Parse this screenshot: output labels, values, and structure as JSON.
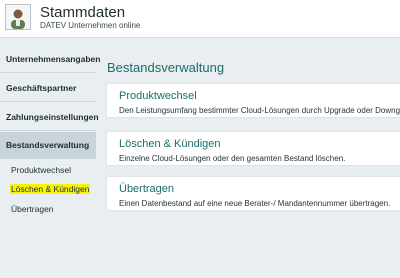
{
  "header": {
    "title": "Stammdaten",
    "subtitle": "DATEV Unternehmen online"
  },
  "sidebar": {
    "items": [
      {
        "label": "Unternehmensangaben"
      },
      {
        "label": "Geschäftspartner"
      },
      {
        "label": "Zahlungseinstellungen"
      },
      {
        "label": "Bestandsverwaltung"
      }
    ],
    "subitems": [
      {
        "label": "Produktwechsel"
      },
      {
        "label": "Löschen & Kündigen"
      },
      {
        "label": "Übertragen"
      }
    ]
  },
  "main": {
    "title": "Bestandsverwaltung",
    "cards": [
      {
        "title": "Produktwechsel",
        "description": "Den Leistungsumfang bestimmter Cloud-Lösungen durch Upgrade oder Downgrade"
      },
      {
        "title": "Löschen & Kündigen",
        "description": "Einzelne Cloud-Lösungen oder den gesamten Bestand löschen."
      },
      {
        "title": "Übertragen",
        "description": "Einen Datenbestand auf eine neue Berater-/ Mandantennummer übertragen."
      }
    ]
  },
  "colors": {
    "accent": "#1b6d6b",
    "active_nav": "#c8d3da",
    "highlight": "#f7f20e",
    "background": "#e9eef1"
  },
  "icons": {
    "avatar": "user-avatar-icon"
  }
}
